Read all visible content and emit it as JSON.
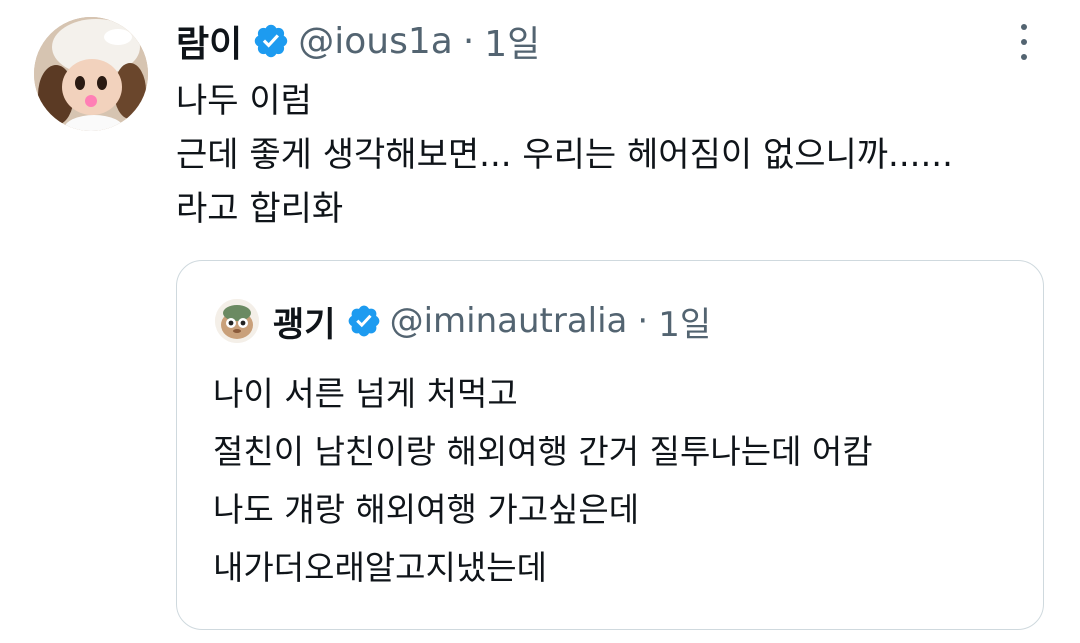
{
  "tweet": {
    "display_name": "람이",
    "handle": "@ious1a",
    "separator": "·",
    "time": "1일",
    "avatar_icon": "doll-avatar",
    "verified_icon": "verified-badge-icon",
    "more_icon": "more-vertical-icon",
    "lines": [
      "나두 이럼",
      "근데 좋게 생각해보면... 우리는 헤어짐이 없으니까......",
      "라고 합리화"
    ]
  },
  "quoted_tweet": {
    "display_name": "괭기",
    "handle": "@iminautralia",
    "separator": "·",
    "time": "1일",
    "avatar_icon": "character-avatar",
    "verified_icon": "verified-badge-icon",
    "lines": [
      "나이 서른 넘게 처먹고",
      "절친이 남친이랑 해외여행 간거 질투나는데 어캄",
      "나도 걔랑 해외여행 가고싶은데",
      "내가더오래알고지냈는데"
    ]
  },
  "colors": {
    "text_primary": "#0f1419",
    "text_secondary": "#536471",
    "verified_blue": "#1d9bf0",
    "border": "#cfd9de"
  }
}
